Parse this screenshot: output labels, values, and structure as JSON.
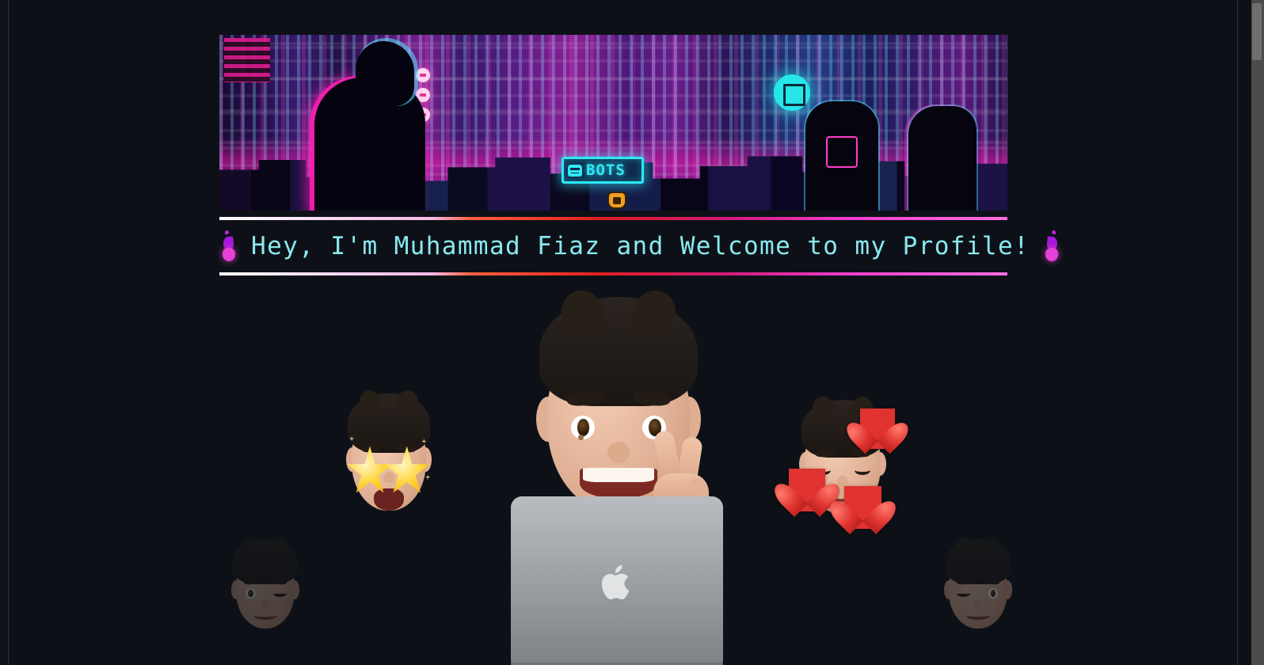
{
  "page": {
    "background_color": "#0d1117",
    "scrollbar": {
      "track_color": "#4b4b4b",
      "thumb_color": "#6e6e6e"
    }
  },
  "banner": {
    "alt": "pixel-art cyberpunk city night scene",
    "sign_text": "BOTS",
    "icons": {
      "robot": "robot-icon",
      "mascot": "orange-mascot-icon",
      "neon_disc": "neon-circle-sign-icon"
    }
  },
  "heading": {
    "left_icon": "flame-icon",
    "right_icon": "flame-icon",
    "text": "Hey, I'm Muhammad Fiaz and Welcome to my Profile!",
    "text_color": "#8ae9f0"
  },
  "dividers": {
    "gradient": "#ffffff → #ff5f3c → #e02020 → #ee3ecf"
  },
  "collage": {
    "items": [
      {
        "name": "memoji-main",
        "label": "memoji waving peace sign"
      },
      {
        "name": "memoji-star",
        "label": "star-struck memoji"
      },
      {
        "name": "memoji-heart",
        "label": "smiling memoji with hearts"
      },
      {
        "name": "memoji-wink-l",
        "label": "winking memoji"
      },
      {
        "name": "memoji-wink-r",
        "label": "winking memoji"
      },
      {
        "name": "macbook",
        "label": "macbook laptop with apple logo"
      }
    ]
  }
}
